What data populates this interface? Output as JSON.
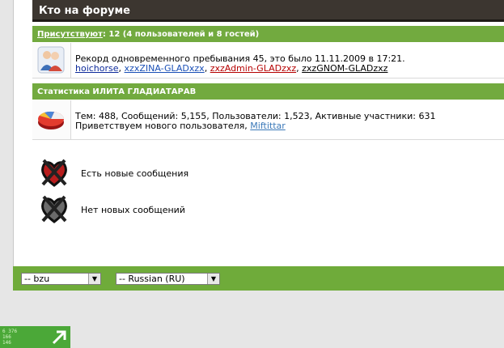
{
  "forum": {
    "header_title": "Кто на форуме",
    "present": {
      "link_label": "Присутствуют",
      "counts": ": 12 (4 пользователей и 8 гостей)"
    },
    "record_text": "Рекорд одновременного пребывания 45, это было 11.11.2009 в 17:21.",
    "online_users": [
      {
        "name": "hoichorse",
        "sep": ", "
      },
      {
        "name": "xzxZINA-GLADxzx",
        "sep": ", "
      },
      {
        "name": "zxzAdmin-GLADzxz",
        "sep": ", "
      },
      {
        "name": "zxzGNOM-GLADzxz",
        "sep": ""
      }
    ],
    "stats_title": "Статистика ИЛИТА ГЛАДИАТАРАВ",
    "stats_text": "Тем: 488, Сообщений: 5,155, Пользователи: 1,523, Активные участники: 631",
    "welcome_text": "Приветствуем нового пользователя,",
    "newest_user": "Miftittar"
  },
  "legend": {
    "new_posts": "Есть новые сообщения",
    "no_new_posts": "Нет новых сообщений"
  },
  "footer": {
    "style_select": "-- bzu",
    "lang_select": "-- Russian (RU)"
  },
  "counter": {
    "line1": "6 376",
    "line2": "166",
    "line3": "146"
  },
  "colors": {
    "header_bg": "#3c3630",
    "green_bar": "#72aa3f",
    "admin_user": "#b50000"
  }
}
